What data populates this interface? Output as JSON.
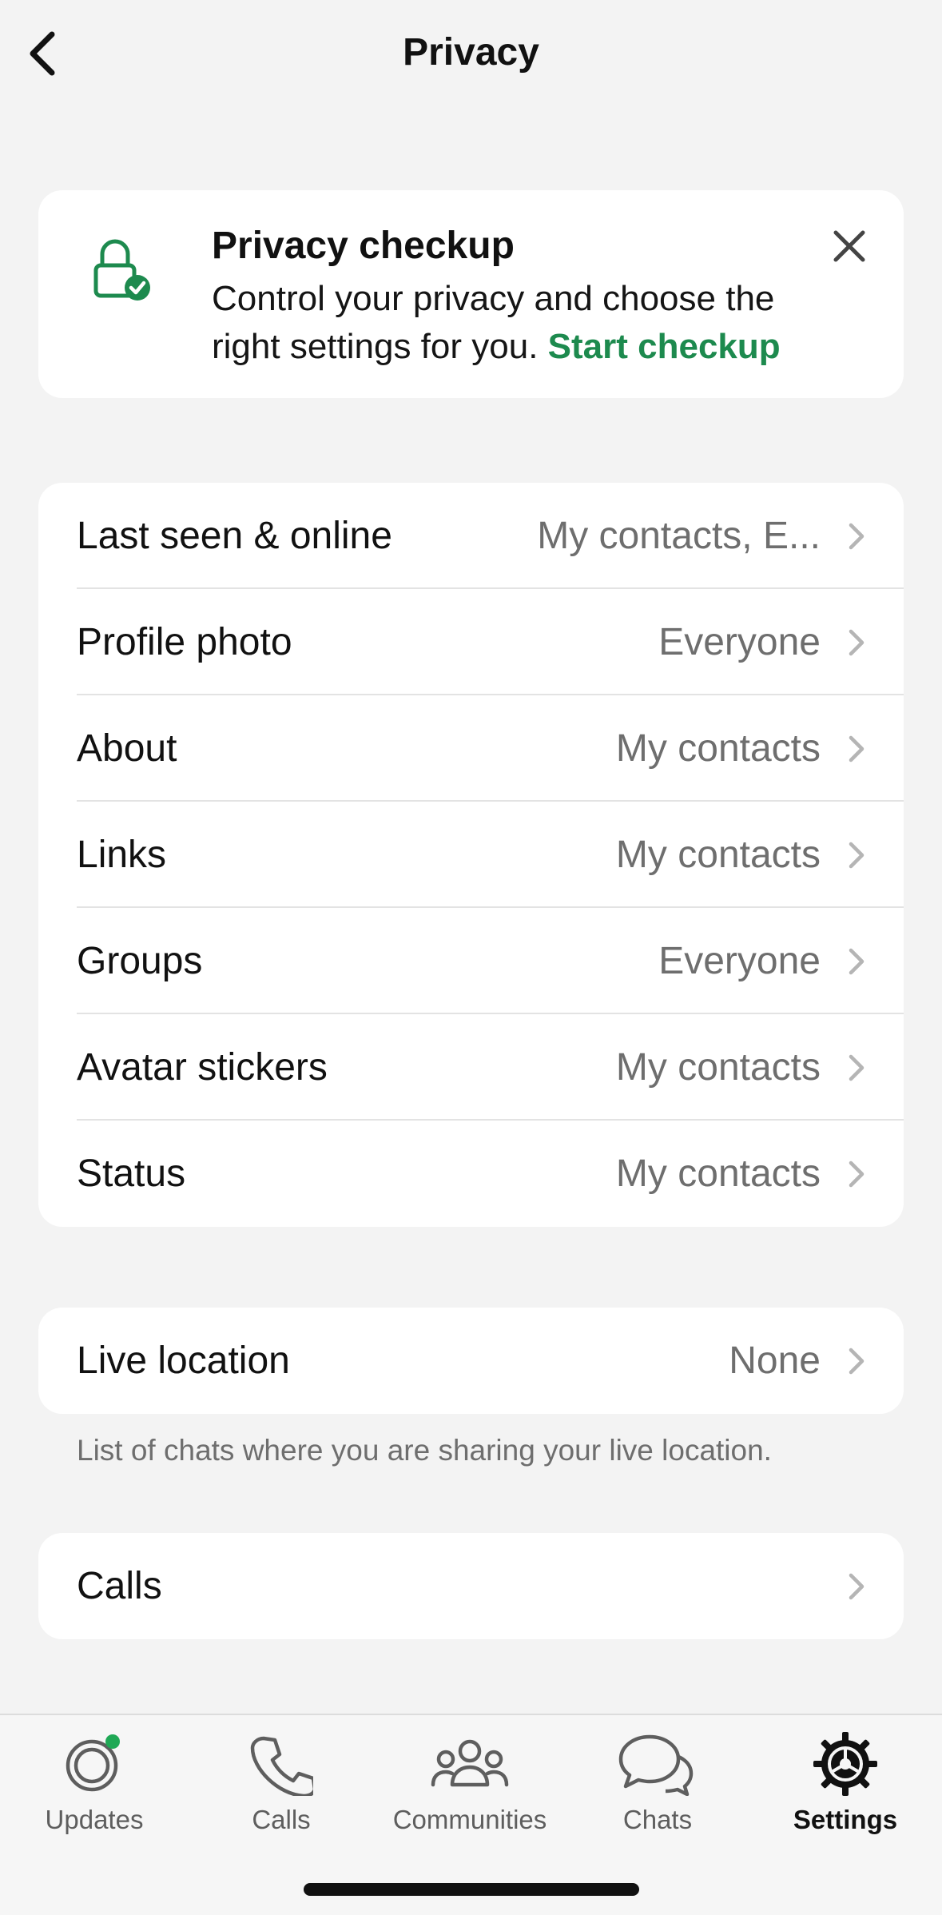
{
  "header": {
    "title": "Privacy"
  },
  "checkup": {
    "title": "Privacy checkup",
    "text": "Control your privacy and choose the right settings for you.",
    "link": "Start checkup"
  },
  "rows": [
    {
      "label": "Last seen & online",
      "value": "My contacts, E..."
    },
    {
      "label": "Profile photo",
      "value": "Everyone"
    },
    {
      "label": "About",
      "value": "My contacts"
    },
    {
      "label": "Links",
      "value": "My contacts"
    },
    {
      "label": "Groups",
      "value": "Everyone"
    },
    {
      "label": "Avatar stickers",
      "value": "My contacts"
    },
    {
      "label": "Status",
      "value": "My contacts"
    }
  ],
  "live_location": {
    "label": "Live location",
    "value": "None",
    "footnote": "List of chats where you are sharing your live location."
  },
  "calls": {
    "label": "Calls"
  },
  "tabs": [
    {
      "label": "Updates",
      "icon": "updates-icon"
    },
    {
      "label": "Calls",
      "icon": "phone-icon"
    },
    {
      "label": "Communities",
      "icon": "communities-icon"
    },
    {
      "label": "Chats",
      "icon": "chats-icon"
    },
    {
      "label": "Settings",
      "icon": "gear-icon",
      "active": true
    }
  ],
  "colors": {
    "accent": "#1d8a4e",
    "background": "#f3f3f3",
    "card": "#ffffff",
    "secondary_text": "#6e6e6e"
  }
}
